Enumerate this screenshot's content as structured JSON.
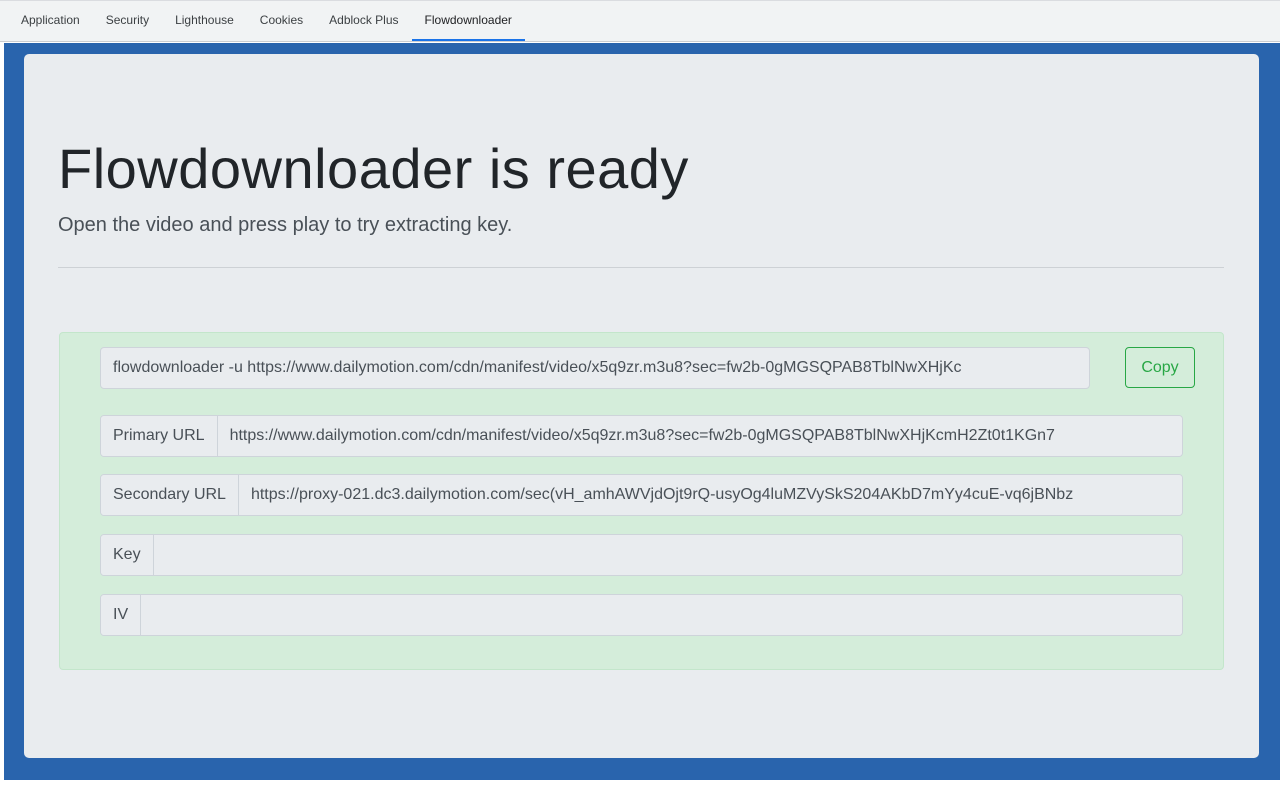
{
  "tabs": [
    {
      "label": "Application",
      "active": false
    },
    {
      "label": "Security",
      "active": false
    },
    {
      "label": "Lighthouse",
      "active": false
    },
    {
      "label": "Cookies",
      "active": false
    },
    {
      "label": "Adblock Plus",
      "active": false
    },
    {
      "label": "Flowdownloader",
      "active": true
    }
  ],
  "colors": {
    "frame": "#2964ad",
    "panel": "#e9ecef",
    "alert_bg": "#d4edda",
    "alert_border": "#c3e6cb",
    "success": "#28a745",
    "tab_active": "#1a73e8"
  },
  "main": {
    "title": "Flowdownloader is ready",
    "subtitle": "Open the video and press play to try extracting key."
  },
  "command": {
    "value": "flowdownloader -u https://www.dailymotion.com/cdn/manifest/video/x5q9zr.m3u8?sec=fw2b-0gMGSQPAB8TblNwXHjKc",
    "copy_label": "Copy"
  },
  "fields": [
    {
      "label": "Primary URL",
      "value": "https://www.dailymotion.com/cdn/manifest/video/x5q9zr.m3u8?sec=fw2b-0gMGSQPAB8TblNwXHjKcmH2Zt0t1KGn7"
    },
    {
      "label": "Secondary URL",
      "value": "https://proxy-021.dc3.dailymotion.com/sec(vH_amhAWVjdOjt9rQ-usyOg4luMZVySkS204AKbD7mYy4cuE-vq6jBNbz"
    },
    {
      "label": "Key",
      "value": ""
    },
    {
      "label": "IV",
      "value": ""
    }
  ]
}
